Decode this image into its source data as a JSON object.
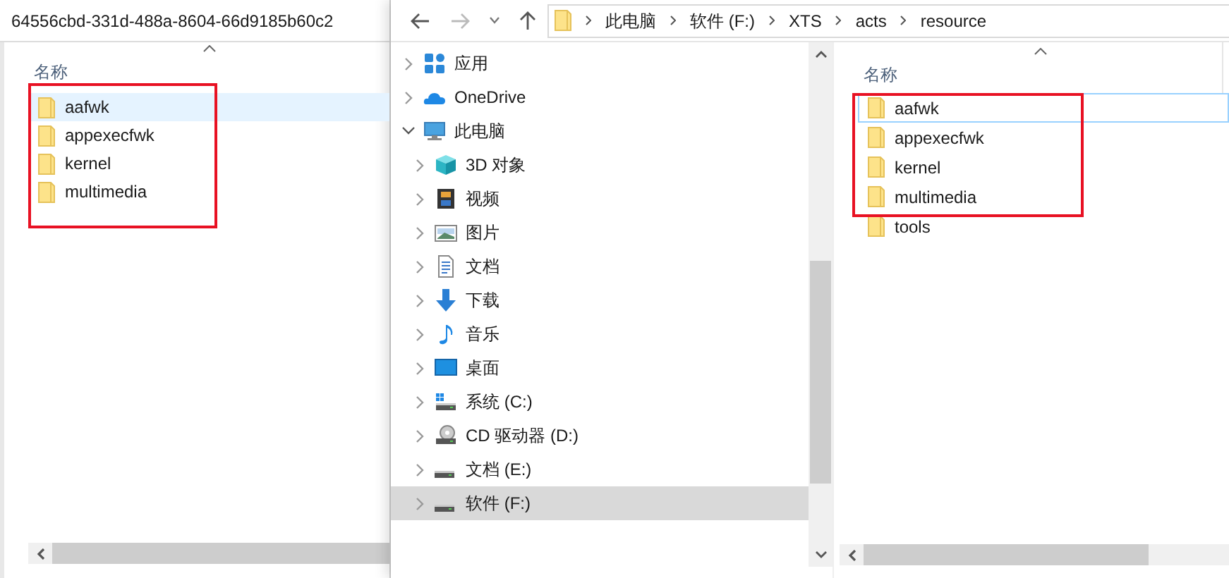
{
  "left_window": {
    "path": "64556cbd-331d-488a-8604-66d9185b60c2",
    "column_header": "名称",
    "files": [
      {
        "name": "aafwk",
        "selected": true,
        "highlighted": true
      },
      {
        "name": "appexecfwk",
        "selected": false,
        "highlighted": true
      },
      {
        "name": "kernel",
        "selected": false,
        "highlighted": true
      },
      {
        "name": "multimedia",
        "selected": false,
        "highlighted": true
      }
    ]
  },
  "right_window": {
    "breadcrumb": [
      "此电脑",
      "软件 (F:)",
      "XTS",
      "acts",
      "resource"
    ],
    "tree": [
      {
        "label": "应用",
        "kind": "apps",
        "expanded": false,
        "selected": false
      },
      {
        "label": "OneDrive",
        "kind": "cloud",
        "expanded": false,
        "selected": false
      },
      {
        "label": "此电脑",
        "kind": "pc",
        "expanded": true,
        "selected": false,
        "children": [
          {
            "label": "3D 对象",
            "kind": "cube",
            "expanded": false,
            "selected": false
          },
          {
            "label": "视频",
            "kind": "video",
            "expanded": false,
            "selected": false
          },
          {
            "label": "图片",
            "kind": "picture",
            "expanded": false,
            "selected": false
          },
          {
            "label": "文档",
            "kind": "document",
            "expanded": false,
            "selected": false
          },
          {
            "label": "下载",
            "kind": "download",
            "expanded": false,
            "selected": false
          },
          {
            "label": "音乐",
            "kind": "music",
            "expanded": false,
            "selected": false
          },
          {
            "label": "桌面",
            "kind": "desktop",
            "expanded": false,
            "selected": false
          },
          {
            "label": "系统 (C:)",
            "kind": "system-drive",
            "expanded": false,
            "selected": false
          },
          {
            "label": "CD 驱动器 (D:)",
            "kind": "cd-drive",
            "expanded": false,
            "selected": false
          },
          {
            "label": "文档 (E:)",
            "kind": "drive",
            "expanded": false,
            "selected": false
          },
          {
            "label": "软件 (F:)",
            "kind": "drive",
            "expanded": false,
            "selected": true
          }
        ]
      }
    ],
    "column_header": "名称",
    "files": [
      {
        "name": "aafwk",
        "focused": true,
        "highlighted": true
      },
      {
        "name": "appexecfwk",
        "focused": false,
        "highlighted": true
      },
      {
        "name": "kernel",
        "focused": false,
        "highlighted": true
      },
      {
        "name": "multimedia",
        "focused": false,
        "highlighted": true
      },
      {
        "name": "tools",
        "focused": false,
        "highlighted": false
      }
    ]
  }
}
